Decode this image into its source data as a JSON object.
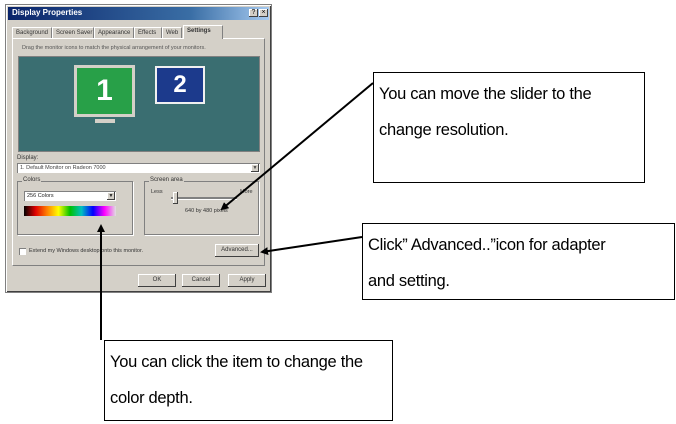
{
  "window": {
    "title": "Display Properties",
    "tabs": [
      "Background",
      "Screen Saver",
      "Appearance",
      "Effects",
      "Web",
      "Settings"
    ],
    "instruction": "Drag the monitor icons to match the physical arrangement of your monitors.",
    "monitors": [
      "1",
      "2"
    ],
    "display_label": "Display:",
    "display_value": "1. Default Monitor on Radeon 7000",
    "colors_label": "Colors",
    "colors_value": "256 Colors",
    "screen_area_label": "Screen area",
    "screen_area_less": "Less",
    "screen_area_more": "More",
    "resolution": "640 by 480 pixels",
    "extend_checkbox": "Extend my Windows desktop onto this monitor.",
    "buttons": {
      "advanced": "Advanced...",
      "ok": "OK",
      "cancel": "Cancel",
      "apply": "Apply"
    }
  },
  "callouts": {
    "slider": [
      "You can move the slider to the",
      "change resolution."
    ],
    "advanced": [
      "Click” Advanced..”icon for adapter",
      "and setting."
    ],
    "colors": [
      "You can click the item to change the",
      "color depth."
    ]
  }
}
